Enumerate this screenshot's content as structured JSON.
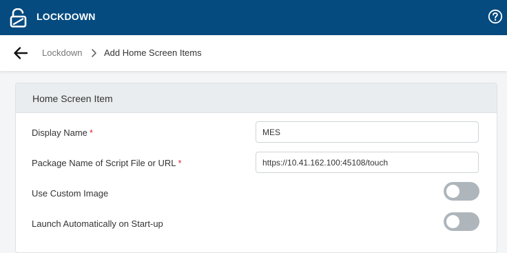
{
  "header": {
    "app_title": "LOCKDOWN",
    "logo_icon": "unlocked-padlock-icon",
    "help_icon": "help-circle-icon"
  },
  "breadcrumb": {
    "back_icon": "arrow-left-icon",
    "parent": "Lockdown",
    "separator_icon": "chevron-right-icon",
    "current": "Add Home Screen Items"
  },
  "form": {
    "section_title": "Home Screen Item",
    "required_marker": "*",
    "fields": {
      "display_name": {
        "label": "Display Name",
        "value": "MES",
        "required": true
      },
      "package_name": {
        "label": "Package Name of Script File or URL",
        "value": "https://10.41.162.100:45108/touch",
        "required": true
      },
      "use_custom_image": {
        "label": "Use Custom Image",
        "enabled": false
      },
      "launch_on_startup": {
        "label": "Launch Automatically on Start-up",
        "enabled": false
      }
    }
  },
  "colors": {
    "topbar": "#054b80",
    "required": "#d9262c",
    "toggle_off": "#aeb6bc"
  }
}
